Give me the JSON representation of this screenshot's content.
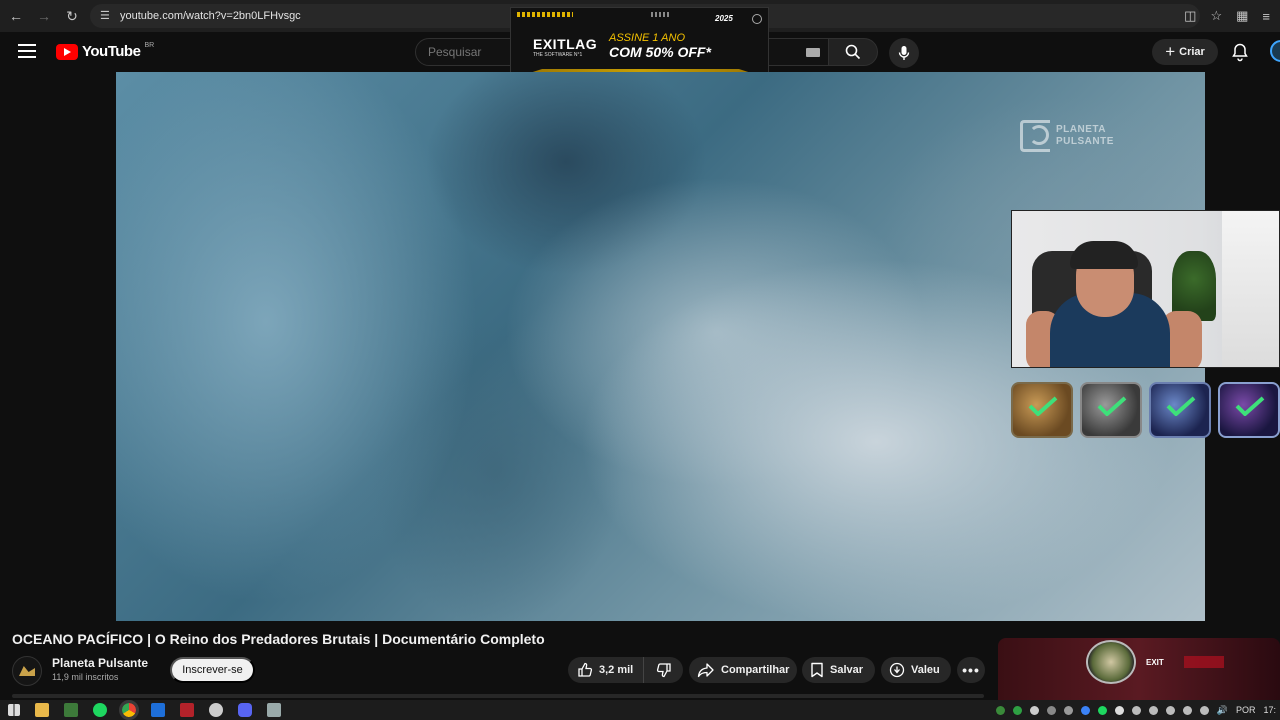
{
  "browser": {
    "url": "youtube.com/watch?v=2bn0LFHvsgc"
  },
  "header": {
    "logo_text": "YouTube",
    "country_code": "BR",
    "search_placeholder": "Pesquisar",
    "create_label": "Criar"
  },
  "ad": {
    "brand": "EXITLAG",
    "brand_sub": "THE SOFTWARE N°1",
    "line1": "ASSINE 1 ANO",
    "line2": "COM 50% OFF*",
    "year": "2025"
  },
  "player": {
    "watermark_line1": "PLANETA",
    "watermark_line2": "PULSANTE"
  },
  "video": {
    "title": "OCEANO PACÍFICO | O Reino dos Predadores Brutais | Documentário Completo",
    "channel_name": "Planeta Pulsante",
    "subscribers": "11,9 mil inscritos",
    "subscribe_label": "Inscrever-se",
    "likes": "3,2 mil",
    "share_label": "Compartilhar",
    "save_label": "Salvar",
    "thanks_label": "Valeu"
  },
  "sidebar": {
    "thumb_text": "EXIT"
  },
  "taskbar": {
    "language": "POR",
    "time": "17:"
  },
  "colors": {
    "accent_red": "#ff0000",
    "background": "#0f0f0f",
    "pill": "#272727"
  }
}
